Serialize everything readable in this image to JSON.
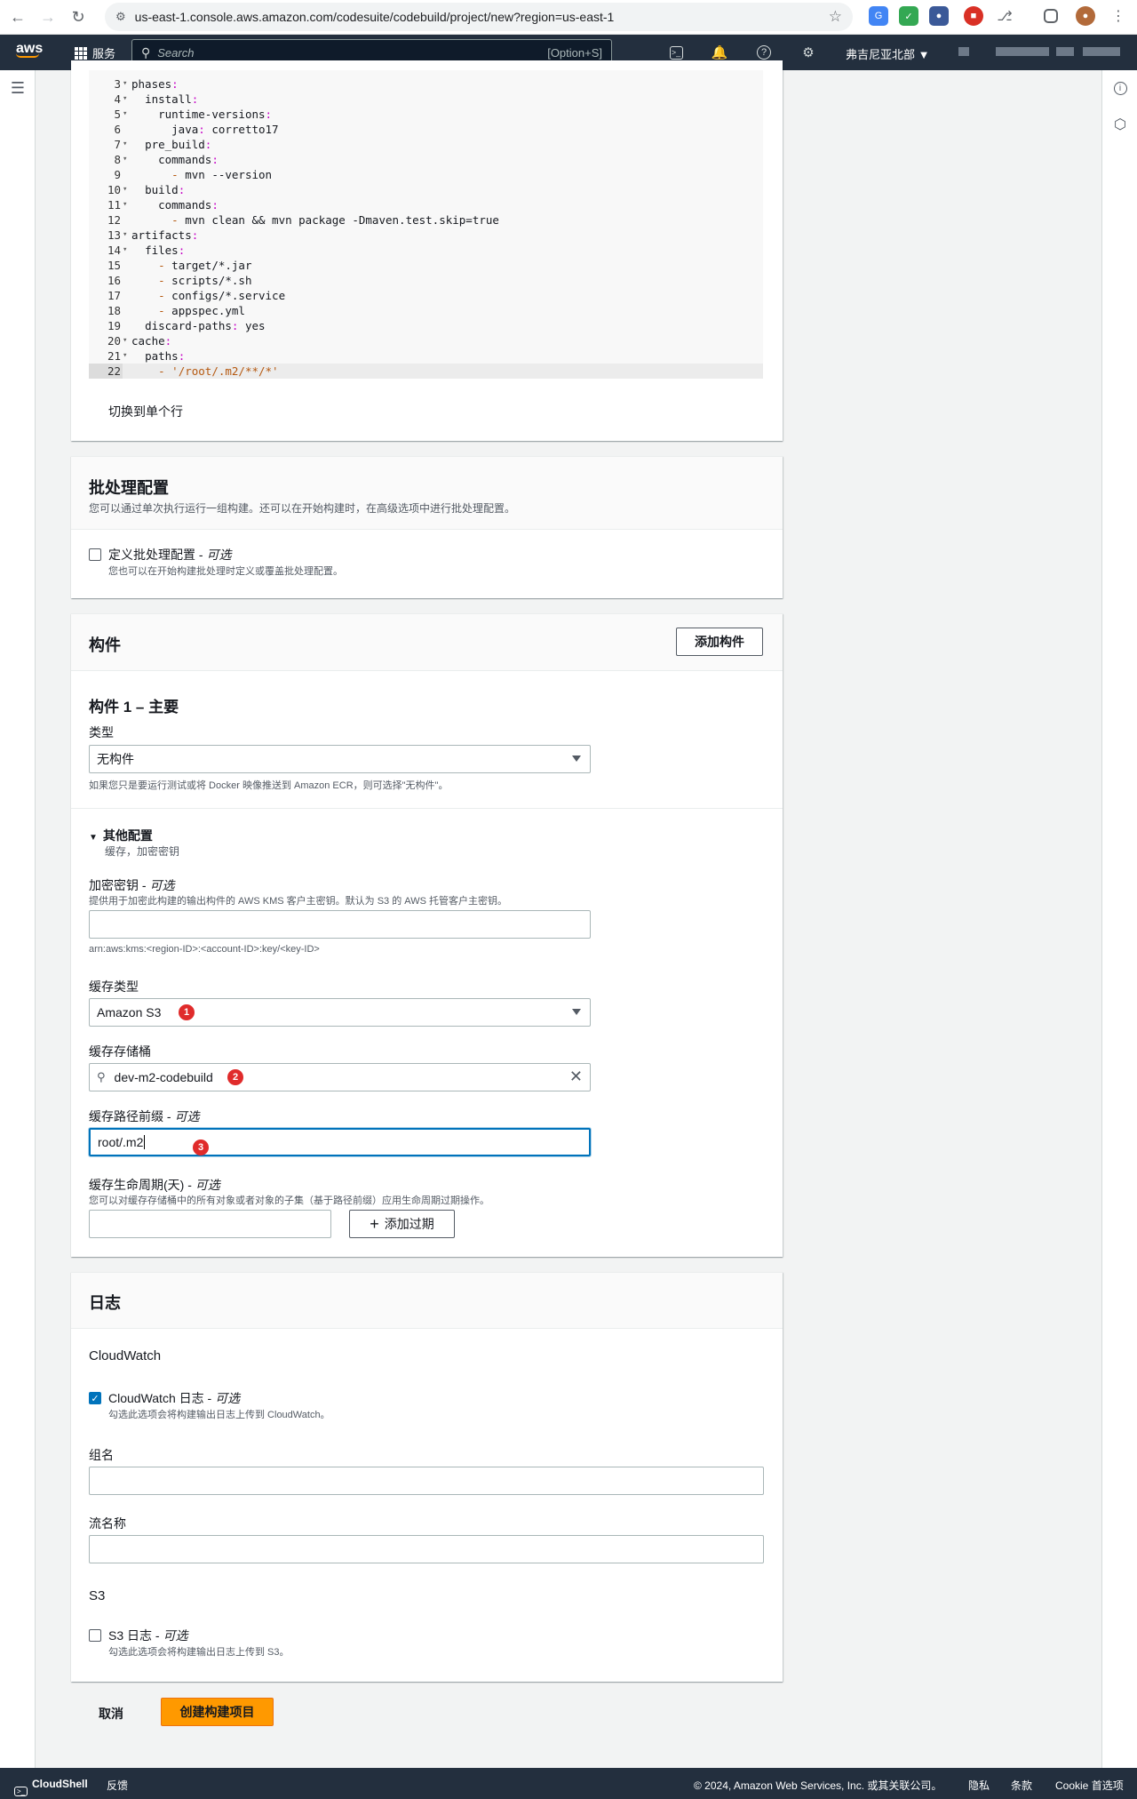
{
  "browser": {
    "url": "us-east-1.console.aws.amazon.com/codesuite/codebuild/project/new?region=us-east-1"
  },
  "header": {
    "services": "服务",
    "search_placeholder": "Search",
    "search_shortcut": "[Option+S]",
    "region": "弗吉尼亚北部 ▼"
  },
  "buildspec": {
    "lines": [
      {
        "n": "3",
        "fold": true,
        "text": "phases:"
      },
      {
        "n": "4",
        "fold": true,
        "text": "  install:"
      },
      {
        "n": "5",
        "fold": true,
        "text": "    runtime-versions:"
      },
      {
        "n": "6",
        "fold": false,
        "text": "      java: corretto17"
      },
      {
        "n": "7",
        "fold": true,
        "text": "  pre_build:"
      },
      {
        "n": "8",
        "fold": true,
        "text": "    commands:"
      },
      {
        "n": "9",
        "fold": false,
        "text": "      - mvn --version"
      },
      {
        "n": "10",
        "fold": true,
        "text": "  build:"
      },
      {
        "n": "11",
        "fold": true,
        "text": "    commands:"
      },
      {
        "n": "12",
        "fold": false,
        "text": "      - mvn clean && mvn package -Dmaven.test.skip=true"
      },
      {
        "n": "13",
        "fold": true,
        "text": "artifacts:"
      },
      {
        "n": "14",
        "fold": true,
        "text": "  files:"
      },
      {
        "n": "15",
        "fold": false,
        "text": "    - target/*.jar"
      },
      {
        "n": "16",
        "fold": false,
        "text": "    - scripts/*.sh"
      },
      {
        "n": "17",
        "fold": false,
        "text": "    - configs/*.service"
      },
      {
        "n": "18",
        "fold": false,
        "text": "    - appspec.yml"
      },
      {
        "n": "19",
        "fold": false,
        "text": "  discard-paths: yes"
      },
      {
        "n": "20",
        "fold": true,
        "text": "cache:"
      },
      {
        "n": "21",
        "fold": true,
        "text": "  paths:"
      },
      {
        "n": "22",
        "fold": false,
        "text": "    - '/root/.m2/**/*'"
      }
    ],
    "switch_label": "切换到单个行"
  },
  "batch": {
    "title": "批处理配置",
    "desc": "您可以通过单次执行运行一组构建。还可以在开始构建时，在高级选项中进行批处理配置。",
    "checkbox_label": "定义批处理配置 - ",
    "optional": "可选",
    "checkbox_help": "您也可以在开始构建批处理时定义或覆盖批处理配置。"
  },
  "artifacts": {
    "title": "构件",
    "add_button": "添加构件",
    "sub_title": "构件 1 – 主要",
    "type_label": "类型",
    "type_value": "无构件",
    "type_help": "如果您只是要运行测试或将 Docker 映像推送到 Amazon ECR，则可选择\"无构件\"。",
    "other_config": "其他配置",
    "other_config_desc": "缓存，加密密钥",
    "kms_label": "加密密钥 - ",
    "optional": "可选",
    "kms_help": "提供用于加密此构建的输出构件的 AWS KMS 客户主密钥。默认为 S3 的 AWS 托管客户主密钥。",
    "kms_hint": "arn:aws:kms:<region-ID>:<account-ID>:key/<key-ID>",
    "cache_type_label": "缓存类型",
    "cache_type_value": "Amazon S3",
    "cache_bucket_label": "缓存存储桶",
    "cache_bucket_value": "dev-m2-codebuild",
    "cache_prefix_label": "缓存路径前缀 - ",
    "cache_prefix_value": "root/.m2",
    "lifecycle_label": "缓存生命周期(天) - ",
    "lifecycle_help": "您可以对缓存存储桶中的所有对象或者对象的子集（基于路径前缀）应用生命周期过期操作。",
    "add_expiry": "添加过期",
    "badges": [
      "1",
      "2",
      "3"
    ]
  },
  "logs": {
    "title": "日志",
    "cloudwatch_heading": "CloudWatch",
    "cloudwatch_checkbox": "CloudWatch 日志 - ",
    "optional": "可选",
    "cloudwatch_help": "勾选此选项会将构建输出日志上传到 CloudWatch。",
    "group_label": "组名",
    "stream_label": "流名称",
    "s3_heading": "S3",
    "s3_checkbox": "S3 日志 - ",
    "s3_help": "勾选此选项会将构建输出日志上传到 S3。"
  },
  "actions": {
    "cancel": "取消",
    "create": "创建构建项目"
  },
  "footer": {
    "cloudshell": "CloudShell",
    "feedback": "反馈",
    "copyright": "© 2024, Amazon Web Services, Inc. 或其关联公司。",
    "privacy": "隐私",
    "terms": "条款",
    "cookie": "Cookie 首选项"
  },
  "colors": {
    "primary_button": "#ff9900",
    "header_bg": "#232f3e",
    "badge": "#e02b2b",
    "focus": "#0073bb"
  }
}
